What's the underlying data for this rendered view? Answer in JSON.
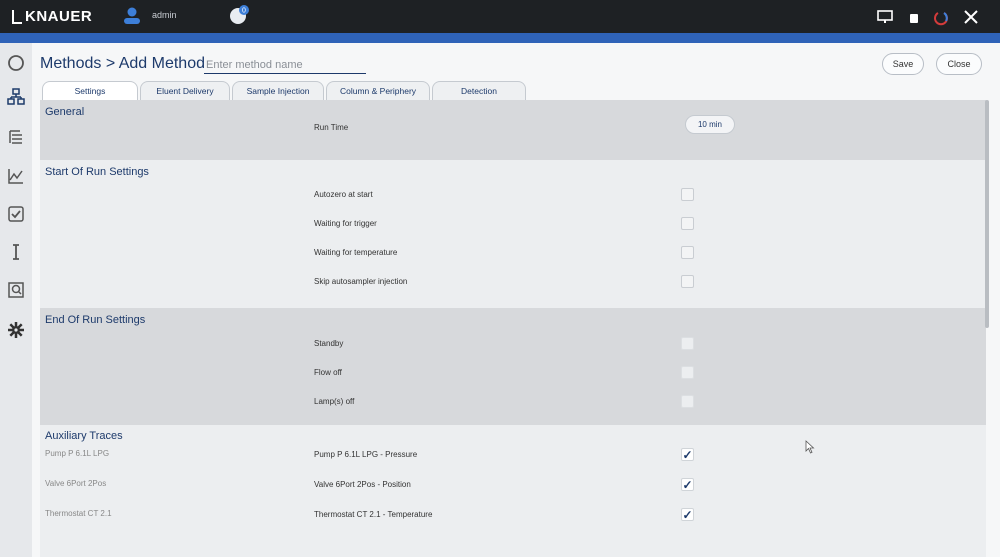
{
  "app": {
    "brand": "KNAUER",
    "user_name": "admin",
    "notification_count": "0"
  },
  "colors": {
    "topbar": "#1e2124",
    "accent": "#2f63b8",
    "text_primary": "#1d3a6b"
  },
  "header": {
    "breadcrumb": "Methods > Add Method",
    "method_name_placeholder": "Enter method name",
    "save_label": "Save",
    "close_label": "Close"
  },
  "tabs": [
    {
      "label": "Settings",
      "active": true
    },
    {
      "label": "Eluent Delivery",
      "active": false
    },
    {
      "label": "Sample Injection",
      "active": false
    },
    {
      "label": "Column & Periphery",
      "active": false
    },
    {
      "label": "Detection",
      "active": false
    }
  ],
  "general": {
    "title": "General",
    "run_time_label": "Run Time",
    "run_time_value": "10 min"
  },
  "start_of_run": {
    "title": "Start Of Run Settings",
    "items": [
      {
        "label": "Autozero at start",
        "checked": false
      },
      {
        "label": "Waiting for trigger",
        "checked": false
      },
      {
        "label": "Waiting for temperature",
        "checked": false
      },
      {
        "label": "Skip autosampler injection",
        "checked": false
      }
    ]
  },
  "end_of_run": {
    "title": "End Of Run Settings",
    "items": [
      {
        "label": "Standby",
        "checked": false
      },
      {
        "label": "Flow off",
        "checked": false
      },
      {
        "label": "Lamp(s) off",
        "checked": false
      }
    ]
  },
  "auxiliary_traces": {
    "title": "Auxiliary Traces",
    "items": [
      {
        "device": "Pump P 6.1L LPG",
        "trace": "Pump P 6.1L LPG - Pressure",
        "checked": true
      },
      {
        "device": "Valve 6Port 2Pos",
        "trace": "Valve 6Port 2Pos - Position",
        "checked": true
      },
      {
        "device": "Thermostat CT 2.1",
        "trace": "Thermostat CT 2.1 - Temperature",
        "checked": true
      }
    ]
  },
  "sidebar": {
    "items": [
      {
        "icon": "circle-icon"
      },
      {
        "icon": "network-icon"
      },
      {
        "icon": "list-tree-icon"
      },
      {
        "icon": "chart-icon"
      },
      {
        "icon": "checkbox-icon"
      },
      {
        "icon": "text-cursor-icon"
      },
      {
        "icon": "search-document-icon"
      },
      {
        "icon": "gear-icon"
      }
    ]
  }
}
